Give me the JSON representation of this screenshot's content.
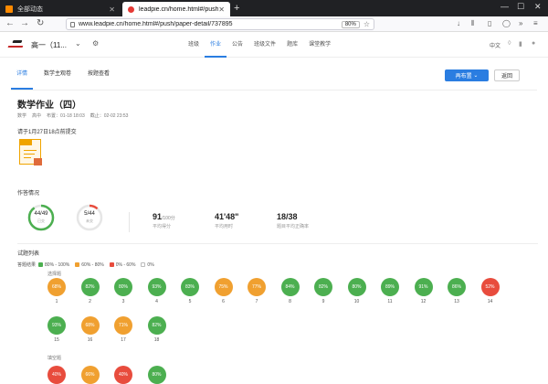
{
  "browser": {
    "tabs": [
      {
        "title": "全部动态",
        "active": false
      },
      {
        "title": "leadpie.cn/home.html#/push",
        "active": true
      }
    ],
    "url": "www.leadpie.cn/home.html#/push/paper-detail/737895",
    "zoom": "80%"
  },
  "header": {
    "class_name": "高一（11...",
    "nav": [
      "班级",
      "作业",
      "公告",
      "班级文件",
      "题库",
      "课堂教学"
    ],
    "active_nav": "作业",
    "language": "中文"
  },
  "subtabs": [
    "详情",
    "数学主观卷",
    "按题查看"
  ],
  "buttons": {
    "primary": "再布置",
    "back": "返回"
  },
  "assignment": {
    "title": "数学作业（四）",
    "meta": [
      "数学",
      "高中",
      "布置：01-18 18:03",
      "截止：02-02 23:53"
    ],
    "instruction": "请于1月27日18点前提交"
  },
  "stats": {
    "section_title": "作答情况",
    "submitted": {
      "value": "44/49",
      "label": "已交",
      "fraction": 0.898
    },
    "unsubmitted": {
      "value": "5/44",
      "label": "未交",
      "fraction": 0.114
    },
    "avg_score": {
      "value": "91",
      "unit": "/100分",
      "label": "平均得分"
    },
    "avg_time": {
      "value": "41'48\"",
      "label": "平均用时"
    },
    "correct": {
      "value": "18/38",
      "label": "题目平均正确率"
    }
  },
  "questions": {
    "section_title": "试题列表",
    "legend_label": "答题结果",
    "legend": [
      {
        "label": "80% - 100%",
        "color": "#4caf50"
      },
      {
        "label": "60% - 80%",
        "color": "#f0a030"
      },
      {
        "label": "0% - 60%",
        "color": "#e84c3d"
      },
      {
        "label": "0%",
        "color": "#ffffff"
      }
    ],
    "groups": [
      {
        "name": "选择题",
        "items": [
          {
            "num": "1",
            "pct": "68%",
            "color": "#f0a030"
          },
          {
            "num": "2",
            "pct": "82%",
            "color": "#4caf50"
          },
          {
            "num": "3",
            "pct": "80%",
            "color": "#4caf50"
          },
          {
            "num": "4",
            "pct": "93%",
            "color": "#4caf50"
          },
          {
            "num": "5",
            "pct": "83%",
            "color": "#4caf50"
          },
          {
            "num": "6",
            "pct": "75%",
            "color": "#f0a030"
          },
          {
            "num": "7",
            "pct": "77%",
            "color": "#f0a030"
          },
          {
            "num": "8",
            "pct": "84%",
            "color": "#4caf50"
          },
          {
            "num": "9",
            "pct": "82%",
            "color": "#4caf50"
          },
          {
            "num": "10",
            "pct": "80%",
            "color": "#4caf50"
          },
          {
            "num": "11",
            "pct": "89%",
            "color": "#4caf50"
          },
          {
            "num": "12",
            "pct": "91%",
            "color": "#4caf50"
          },
          {
            "num": "13",
            "pct": "86%",
            "color": "#4caf50"
          },
          {
            "num": "14",
            "pct": "52%",
            "color": "#e84c3d"
          },
          {
            "num": "15",
            "pct": "93%",
            "color": "#4caf50"
          },
          {
            "num": "16",
            "pct": "68%",
            "color": "#f0a030"
          },
          {
            "num": "17",
            "pct": "71%",
            "color": "#f0a030"
          },
          {
            "num": "18",
            "pct": "82%",
            "color": "#4caf50"
          }
        ]
      },
      {
        "name": "填空题",
        "items": [
          {
            "pct": "40%",
            "color": "#e84c3d"
          },
          {
            "pct": "66%",
            "color": "#f0a030"
          },
          {
            "pct": "40%",
            "color": "#e84c3d"
          },
          {
            "pct": "80%",
            "color": "#4caf50"
          }
        ]
      }
    ]
  }
}
